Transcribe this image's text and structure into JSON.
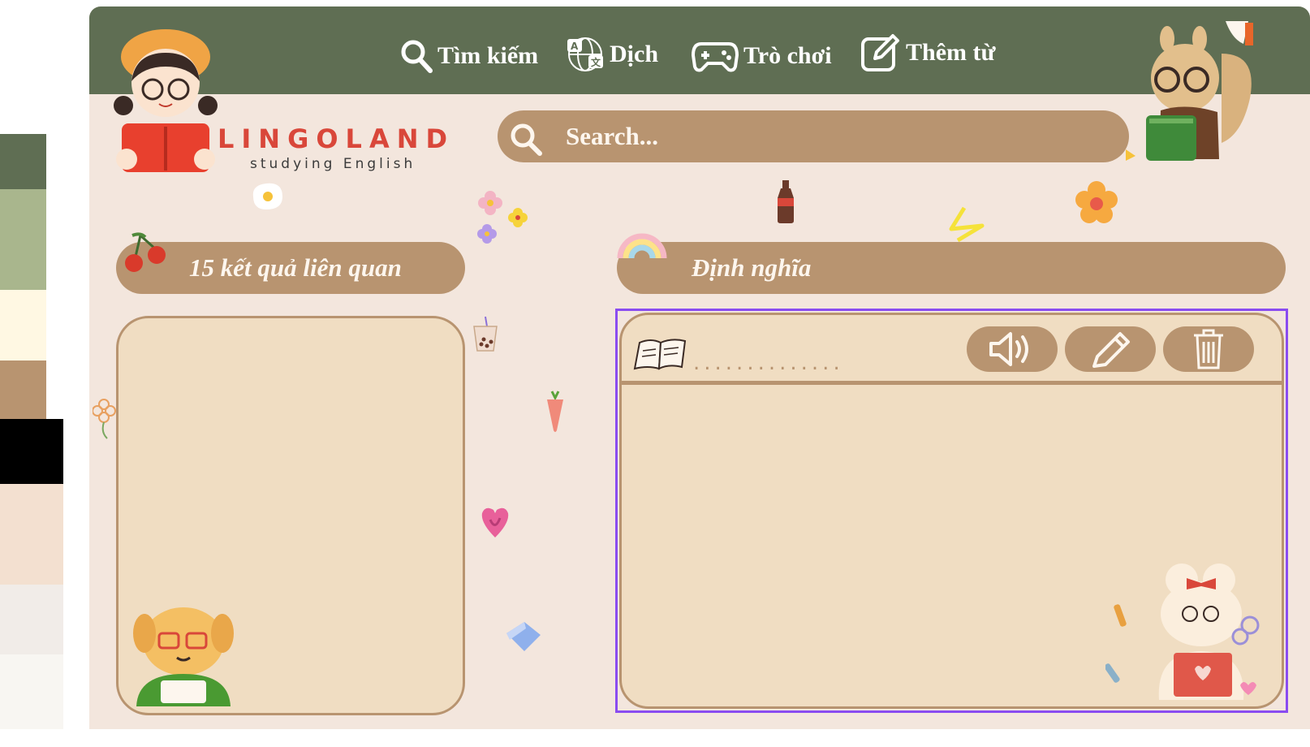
{
  "palette": [
    {
      "color": "#5f6e53",
      "height": 68
    },
    {
      "color": "#a9b68d",
      "height": 124
    },
    {
      "color": "#fff8e3",
      "height": 87
    },
    {
      "color": "#b89470",
      "height": 72
    },
    {
      "color": "#000000",
      "height": 80,
      "wide": true
    },
    {
      "color": "#f3e0d0",
      "height": 124,
      "wide": true
    },
    {
      "color": "#f1ece8",
      "height": 86,
      "wide": true
    },
    {
      "color": "#f8f6f2",
      "height": 92,
      "wide": true
    }
  ],
  "nav": {
    "search": "Tìm kiếm",
    "translate": "Dịch",
    "games": "Trò chơi",
    "add_word": "Thêm từ"
  },
  "logo": {
    "title": "LINGOLAND",
    "subtitle": "studying English"
  },
  "search": {
    "placeholder": "Search..."
  },
  "results": {
    "label": "15 kết quả liên quan"
  },
  "definition": {
    "label": "Định nghĩa",
    "word_placeholder": "..............",
    "content": ""
  },
  "icons": {
    "search": "search-icon",
    "translate": "translate-icon",
    "games": "gamepad-icon",
    "add": "edit-icon",
    "speaker": "speaker-icon",
    "edit": "pencil-icon",
    "delete": "trash-icon",
    "book": "open-book-icon"
  },
  "colors": {
    "header": "#5f6e53",
    "accent": "#b89470",
    "background": "#f3e6dd",
    "panel": "#f0ddc2",
    "selection": "#8a4cf0",
    "logo": "#d9473a"
  }
}
